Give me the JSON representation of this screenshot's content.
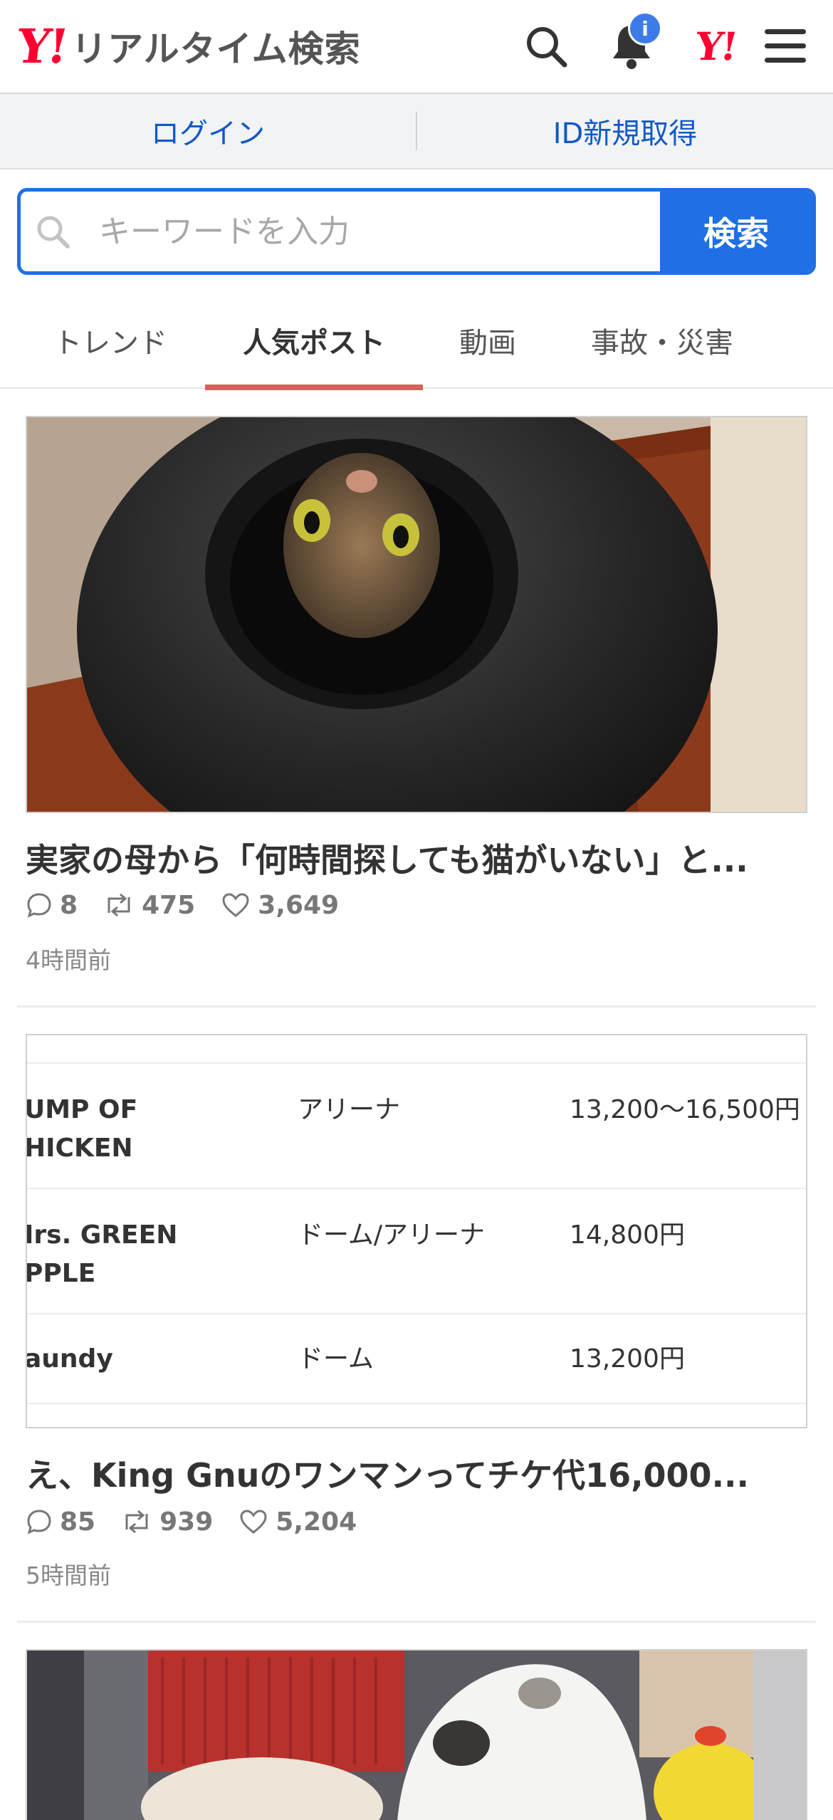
{
  "header": {
    "logo_mark": "Y!",
    "title": "リアルタイム検索",
    "notification_badge": "i",
    "yj_mark": "Y!"
  },
  "loginbar": {
    "login": "ログイン",
    "register": "ID新規取得"
  },
  "search": {
    "placeholder": "キーワードを入力",
    "button": "検索"
  },
  "tabs": [
    {
      "label": "トレンド",
      "active": false
    },
    {
      "label": "人気ポスト",
      "active": true
    },
    {
      "label": "動画",
      "active": false
    },
    {
      "label": "事故・災害",
      "active": false
    }
  ],
  "posts": [
    {
      "image": "cat-in-pot-photo",
      "title": "実家の母から「何時間探しても猫がいない」と...",
      "replies": "8",
      "reposts": "475",
      "likes": "3,649",
      "time": "4時間前"
    },
    {
      "image": "ticket-price-table",
      "table": [
        {
          "artist": [
            "UMP OF",
            "HICKEN"
          ],
          "venue": "アリーナ",
          "price": "13,200～16,500円"
        },
        {
          "artist": [
            "Irs. GREEN",
            "PPLE"
          ],
          "venue": "ドーム/アリーナ",
          "price": "14,800円"
        },
        {
          "artist": [
            "aundy"
          ],
          "venue": "ドーム",
          "price": "13,200円"
        }
      ],
      "title": "え、King Gnuのワンマンってチケ代16,000...",
      "replies": "85",
      "reposts": "939",
      "likes": "5,204",
      "time": "5時間前"
    },
    {
      "image": "cat-in-drawer-photo"
    }
  ],
  "colors": {
    "brand_red": "#ff0033",
    "accent_blue": "#1f6fe5",
    "tab_underline": "#e05b5b",
    "link_blue": "#1158c7"
  }
}
